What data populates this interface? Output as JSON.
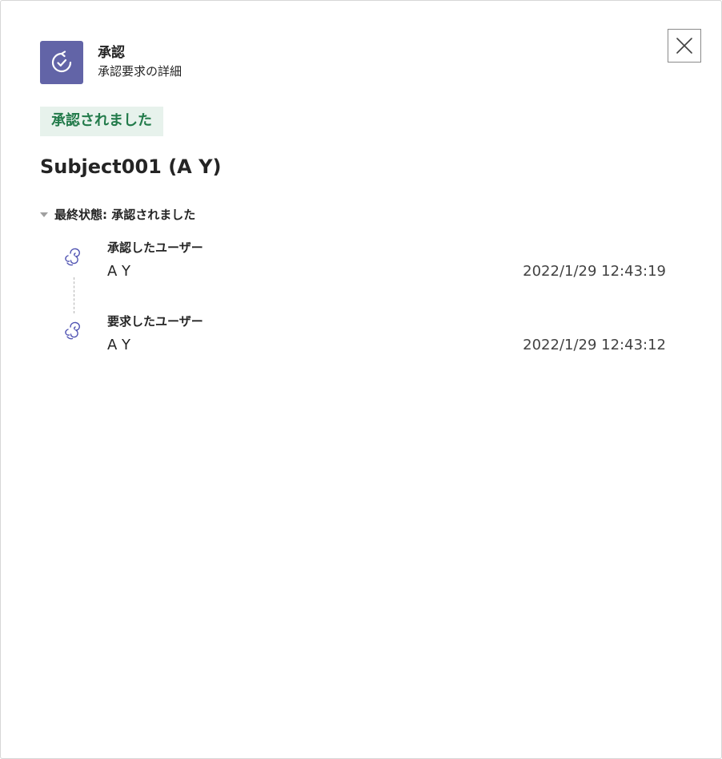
{
  "app": {
    "title": "承認",
    "subtitle": "承認要求の詳細",
    "accent_color": "#6264a7",
    "icon": "approvals-icon"
  },
  "close_icon": "close-icon",
  "status": {
    "label": "承認されました",
    "text_color": "#237b4b",
    "background_color": "#e7f2ec"
  },
  "request": {
    "title": "Subject001 (A Y)"
  },
  "final_state": {
    "label": "最終状態: 承認されました"
  },
  "timeline": [
    {
      "role": "承認したユーザー",
      "name": "A Y",
      "timestamp": "2022/1/29 12:43:19",
      "icon": "user-avatar-icon"
    },
    {
      "role": "要求したユーザー",
      "name": "A Y",
      "timestamp": "2022/1/29 12:43:12",
      "icon": "user-avatar-icon"
    }
  ]
}
